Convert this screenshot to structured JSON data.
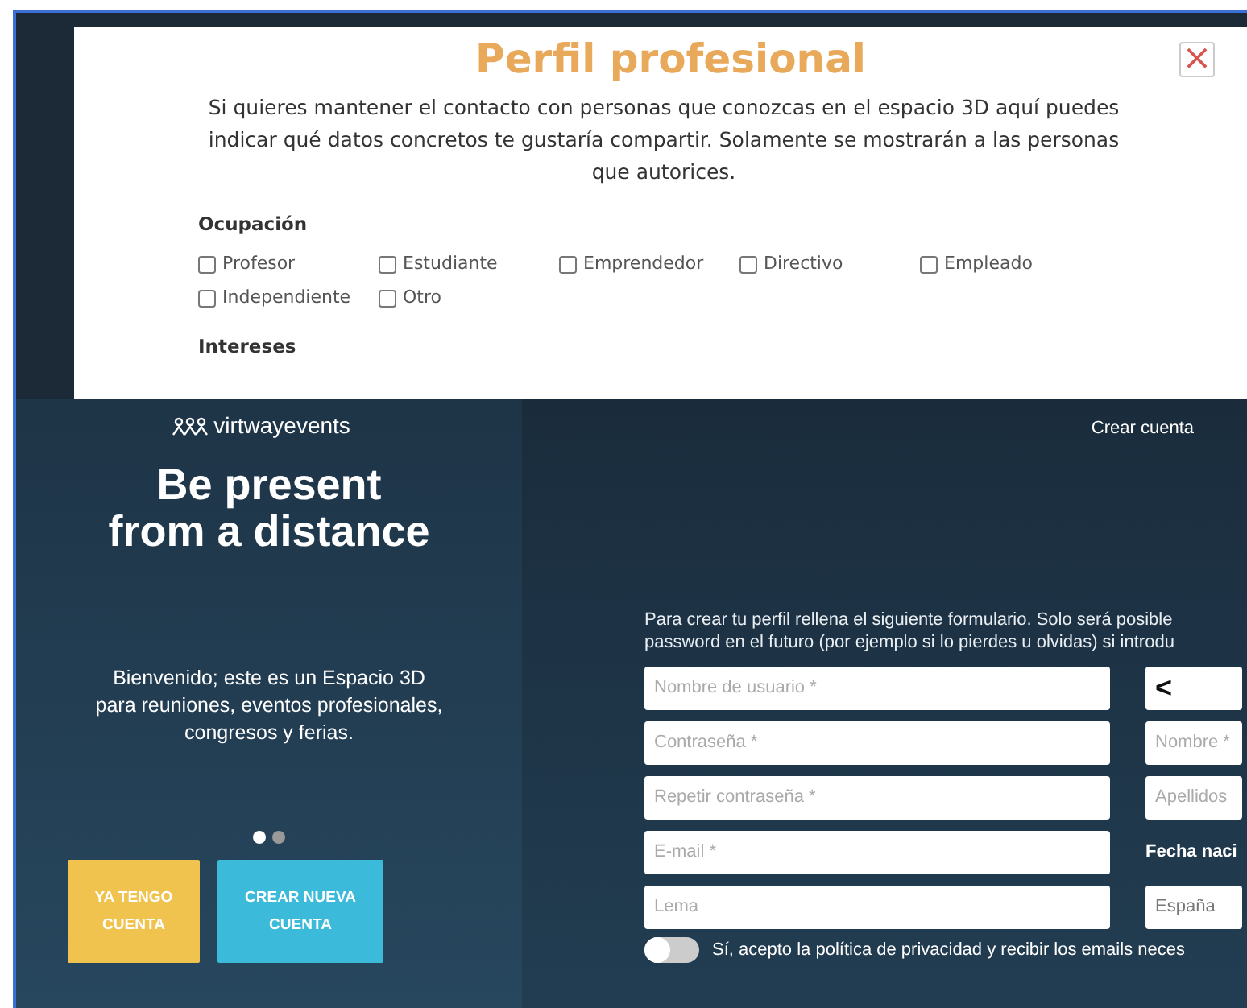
{
  "modal": {
    "title": "Perfil profesional",
    "close": "×",
    "intro": "Si quieres mantener el contacto con personas que conozcas en el espacio 3D aquí puedes indicar qué datos concretos te gustaría compartir. Solamente se mostrarán a las personas que autorices.",
    "sections": [
      {
        "heading": "Ocupación",
        "options": [
          {
            "label": "Profesor",
            "checked": false
          },
          {
            "label": "Estudiante",
            "checked": false
          },
          {
            "label": "Emprendedor",
            "checked": false
          },
          {
            "label": "Directivo",
            "checked": false
          },
          {
            "label": "Empleado",
            "checked": false
          },
          {
            "label": "Independiente",
            "checked": false
          },
          {
            "label": "Otro",
            "checked": false
          }
        ]
      },
      {
        "heading": "Intereses"
      }
    ]
  },
  "left_panel": {
    "logo": "virtwayevents",
    "headline": [
      "Be present",
      "from a distance"
    ],
    "welcome": [
      "Bienvenido; este es un Espacio 3D",
      "para reuniones, eventos profesionales,",
      "congresos y ferias."
    ],
    "slides": [
      {
        "selected": true
      },
      {
        "selected": false
      }
    ],
    "buttons": [
      {
        "kind": "login",
        "lines": [
          "YA TENGO",
          "CUENTA"
        ]
      },
      {
        "kind": "register",
        "lines": [
          "CREAR NUEVA",
          "CUENTA"
        ]
      }
    ]
  },
  "right_panel": {
    "nav_link": "Crear cuenta",
    "intro": [
      "Para crear tu perfil rellena el siguiente formulario. Solo será posible",
      "password en el futuro (por ejemplo si lo pierdes u olvidas) si introdu"
    ],
    "left_fields": [
      {
        "placeholder": "Nombre de usuario *"
      },
      {
        "placeholder": "Contraseña *"
      },
      {
        "placeholder": "Repetir contraseña *"
      },
      {
        "placeholder": "E-mail *"
      },
      {
        "placeholder": "Lema"
      }
    ],
    "right_fields": [
      {
        "kind": "back",
        "text": "<"
      },
      {
        "kind": "input",
        "placeholder": "Nombre *"
      },
      {
        "kind": "input",
        "placeholder": "Apellidos"
      },
      {
        "kind": "label",
        "text": "Fecha naci"
      },
      {
        "kind": "select",
        "value": "España"
      }
    ],
    "consent": {
      "on": false,
      "label": "Sí, acepto la política de privacidad y recibir los emails neces"
    }
  }
}
